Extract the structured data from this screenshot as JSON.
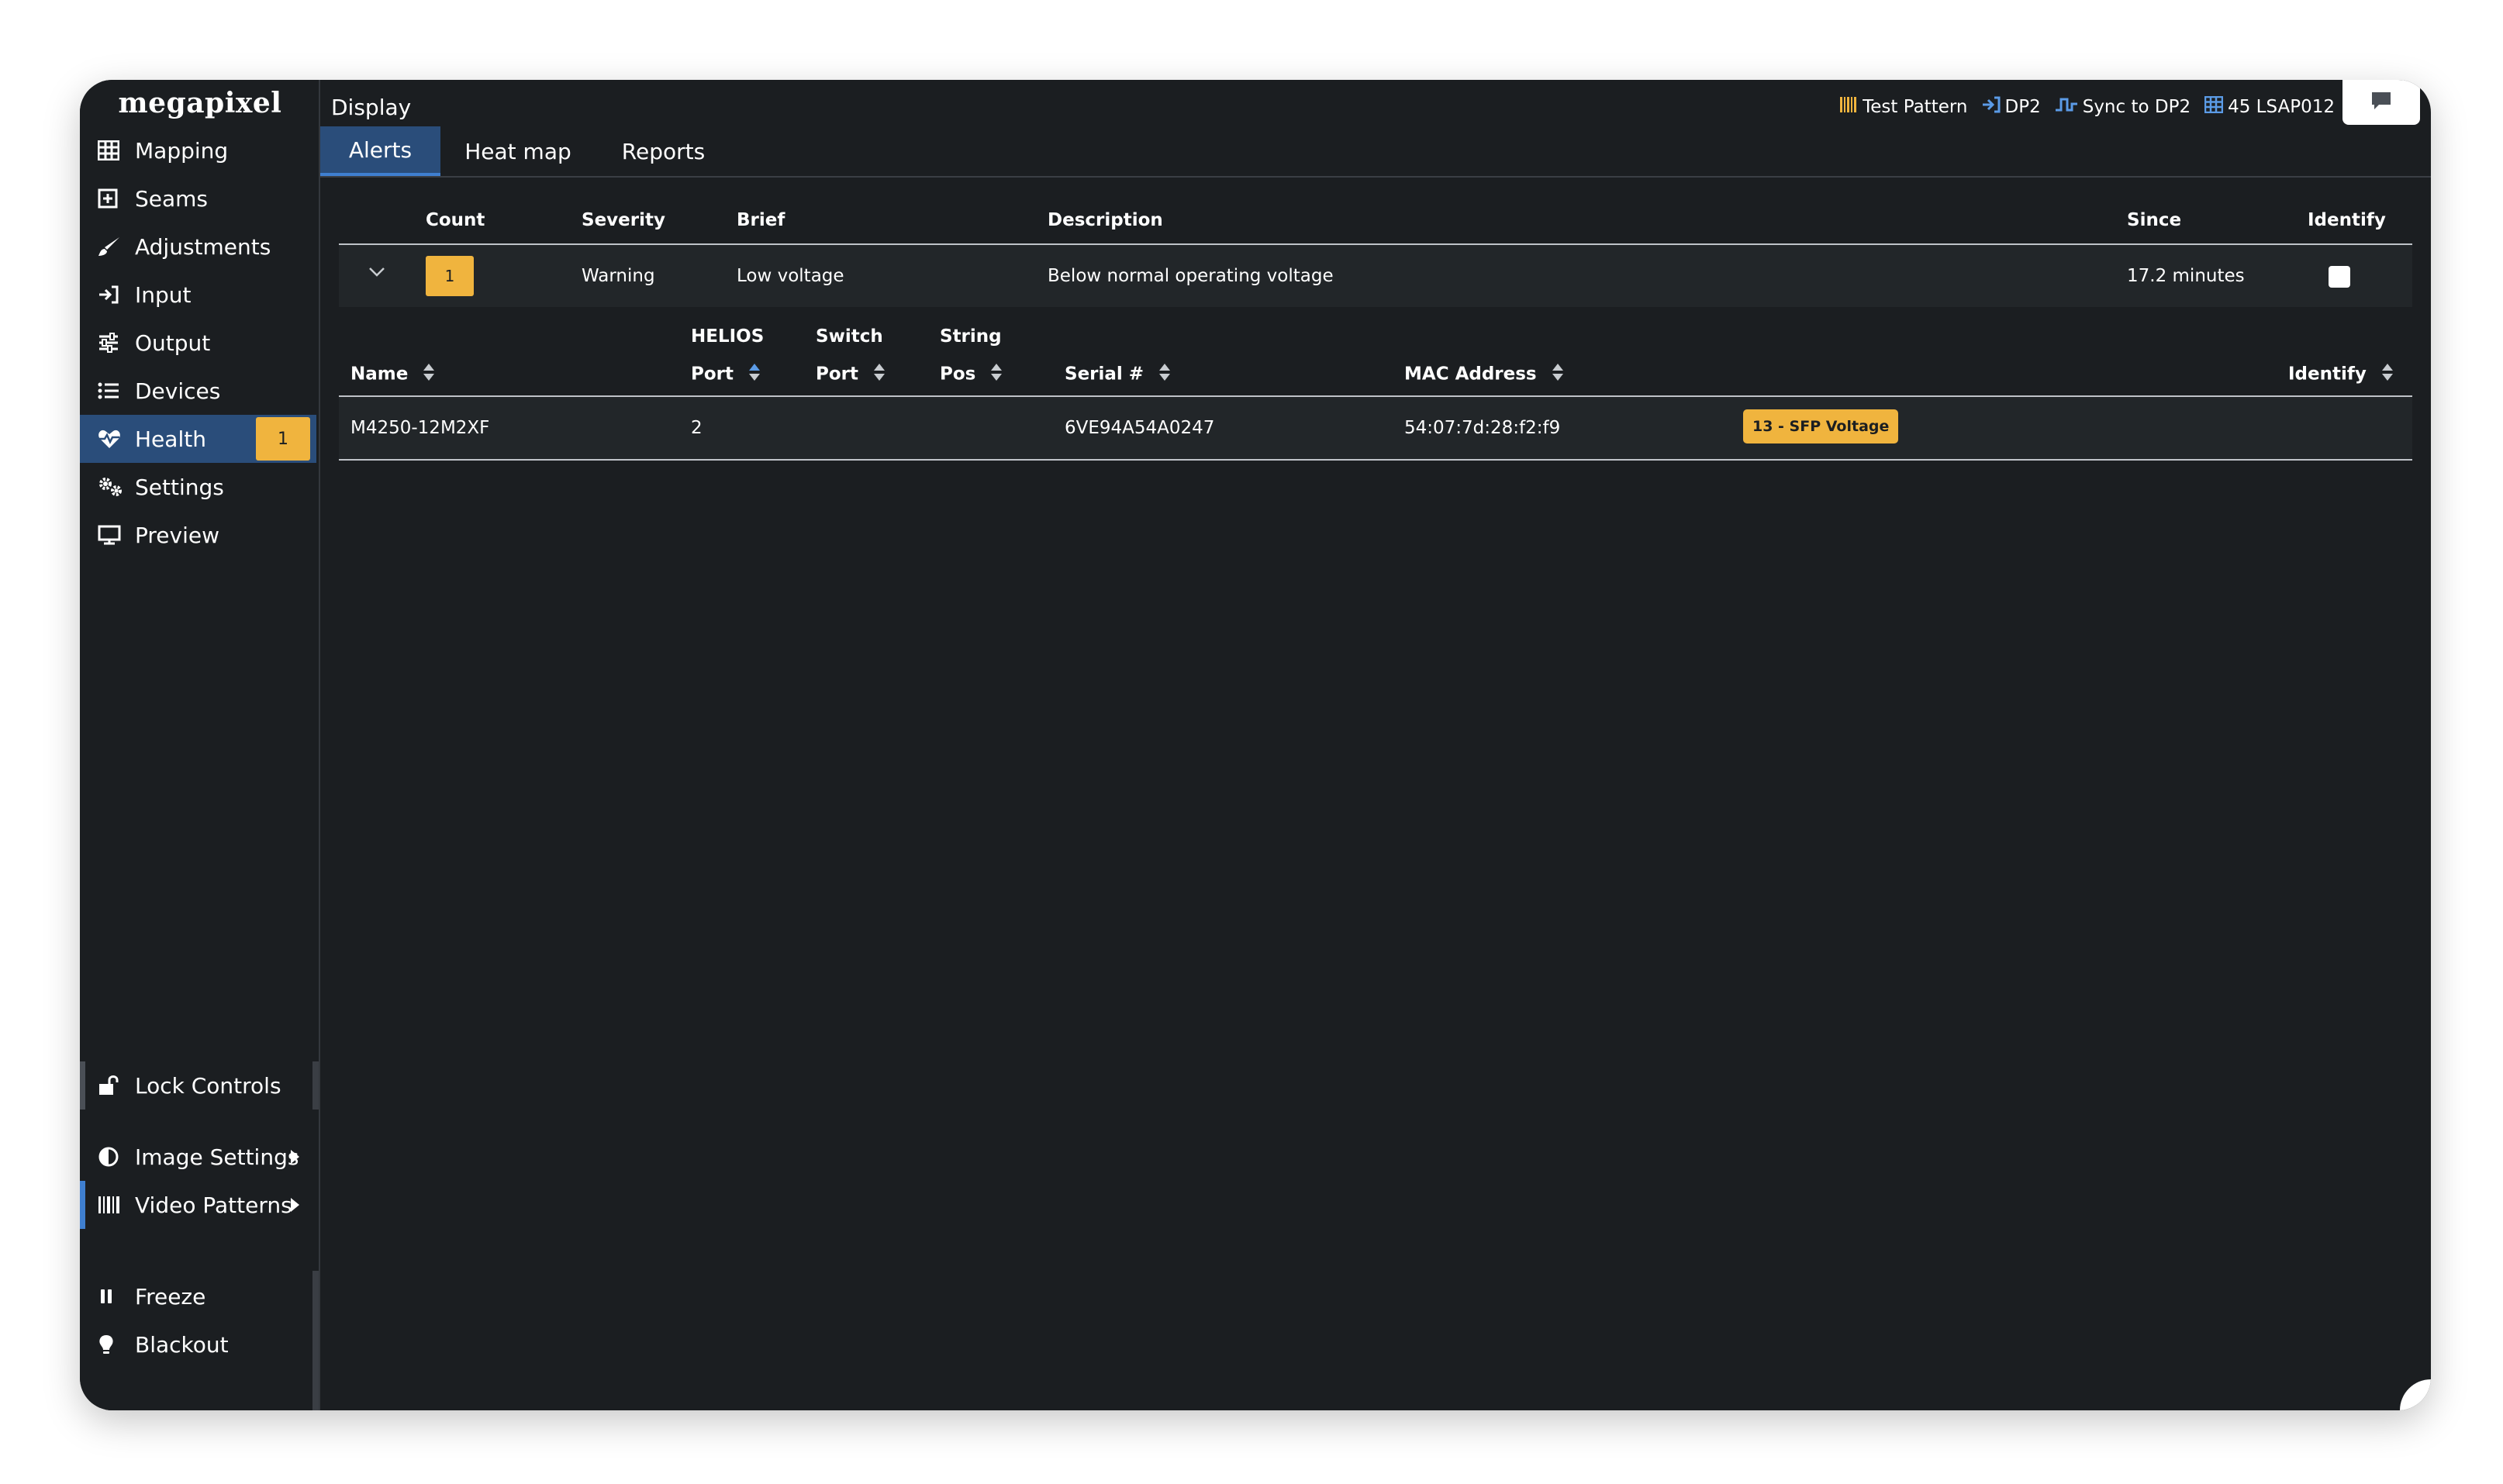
{
  "app": {
    "logo": "megapixel",
    "page_title": "Display"
  },
  "status_bar": [
    {
      "icon": "test-pattern-icon",
      "label": "Test Pattern",
      "color": "#f0b43e"
    },
    {
      "icon": "input-icon",
      "label": "DP2",
      "color": "#5b9be6"
    },
    {
      "icon": "sync-icon",
      "label": "Sync to DP2",
      "color": "#5b9be6"
    },
    {
      "icon": "grid-icon",
      "label": "45 LSAP012",
      "color": "#5b9be6"
    }
  ],
  "sidebar": {
    "items": [
      {
        "id": "mapping",
        "label": "Mapping",
        "icon": "grid-icon"
      },
      {
        "id": "seams",
        "label": "Seams",
        "icon": "plus-square-icon"
      },
      {
        "id": "adjustments",
        "label": "Adjustments",
        "icon": "brush-icon"
      },
      {
        "id": "input",
        "label": "Input",
        "icon": "sign-in-icon"
      },
      {
        "id": "output",
        "label": "Output",
        "icon": "sliders-icon"
      },
      {
        "id": "devices",
        "label": "Devices",
        "icon": "list-icon"
      },
      {
        "id": "health",
        "label": "Health",
        "icon": "heart-pulse-icon",
        "badge": "1",
        "active": true
      },
      {
        "id": "settings",
        "label": "Settings",
        "icon": "gears-icon"
      },
      {
        "id": "preview",
        "label": "Preview",
        "icon": "monitor-icon"
      }
    ],
    "bottom": {
      "lock_controls": "Lock Controls",
      "image_settings": "Image Settings",
      "video_patterns": "Video Patterns",
      "freeze": "Freeze",
      "blackout": "Blackout"
    }
  },
  "tabs": [
    {
      "label": "Alerts",
      "active": true
    },
    {
      "label": "Heat map"
    },
    {
      "label": "Reports"
    }
  ],
  "alerts_table": {
    "headers": {
      "count": "Count",
      "severity": "Severity",
      "brief": "Brief",
      "description": "Description",
      "since": "Since",
      "identify": "Identify"
    },
    "rows": [
      {
        "count": "1",
        "severity": "Warning",
        "brief": "Low voltage",
        "description": "Below normal operating voltage",
        "since": "17.2 minutes",
        "identify": false
      }
    ]
  },
  "detail_table": {
    "headers": {
      "name": "Name",
      "helios_top": "HELIOS",
      "helios_bottom": "Port",
      "switch_top": "Switch",
      "switch_bottom": "Port",
      "string_top": "String",
      "string_bottom": "Pos",
      "serial": "Serial #",
      "mac": "MAC Address",
      "identify": "Identify"
    },
    "rows": [
      {
        "name": "M4250-12M2XF",
        "helios_port": "2",
        "switch_port": "",
        "string_pos": "",
        "serial": "6VE94A54A0247",
        "mac": "54:07:7d:28:f2:f9",
        "tag": "13 - SFP Voltage"
      }
    ]
  },
  "colors": {
    "accent_blue": "#2a4d7a",
    "badge_yellow": "#f0b43e",
    "background": "#1b1e21"
  }
}
